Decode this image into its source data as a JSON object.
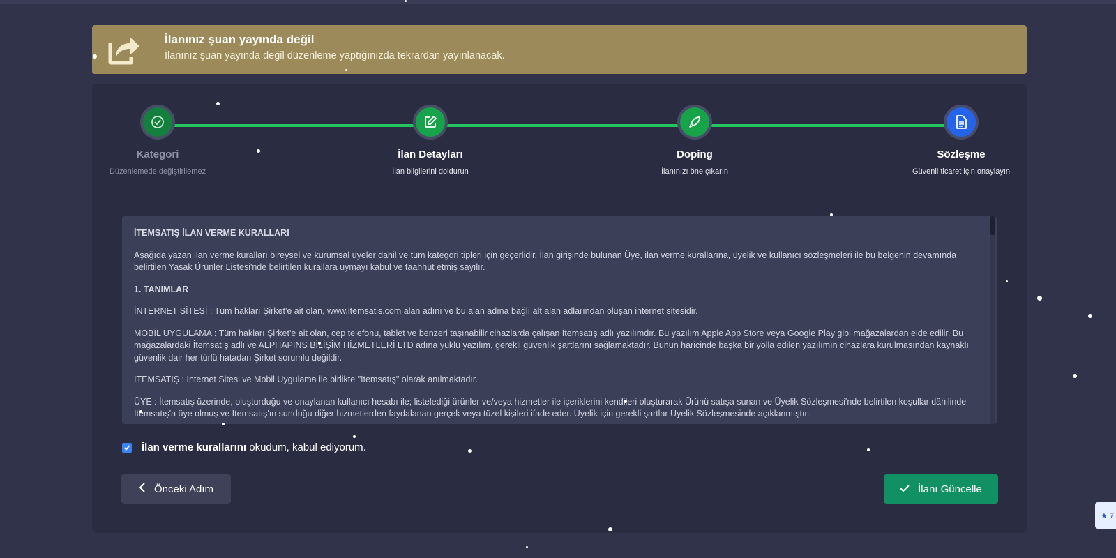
{
  "banner": {
    "title": "İlanınız şuan yayında değil",
    "subtitle": "İlanınız şuan yayında değil düzenleme yaptığınızda tekrardan yayınlanacak.",
    "icon": "share-export-icon"
  },
  "steps": [
    {
      "title": "Kategori",
      "subtitle": "Düzenlemede değiştirilemez",
      "icon": "check-circle-icon",
      "state": "disabled"
    },
    {
      "title": "İlan Detayları",
      "subtitle": "İlan bilgilerini doldurun",
      "icon": "edit-icon",
      "state": "done"
    },
    {
      "title": "Doping",
      "subtitle": "İlanınızı öne çıkarın",
      "icon": "rocket-icon",
      "state": "done"
    },
    {
      "title": "Sözleşme",
      "subtitle": "Güvenli ticaret için onaylayın",
      "icon": "document-icon",
      "state": "active"
    }
  ],
  "rules": {
    "heading": "İTEMSATIŞ İLAN VERME KURALLARI",
    "intro": "Aşağıda yazan ilan verme kuralları bireysel ve kurumsal üyeler dahil ve tüm kategori tipleri için geçerlidir. İlan girişinde bulunan Üye, ilan verme kurallarına, üyelik ve kullanıcı sözleşmeleri ile bu belgenin devamında belirtilen Yasak Ürünler Listesi'nde belirtilen kurallara uymayı kabul ve taahhüt etmiş sayılır.",
    "section1": "1. TANIMLAR",
    "def_internet": "İNTERNET SİTESİ : Tüm hakları Şirket'e ait olan, www.itemsatis.com alan adını ve bu alan adına bağlı alt alan adlarından oluşan internet sitesidir.",
    "def_mobile": "MOBİL UYGULAMA : Tüm hakları Şirket'e ait olan, cep telefonu, tablet ve benzeri taşınabilir cihazlarda çalışan İtemsatış adlı yazılımdır. Bu yazılım Apple App Store veya Google Play gibi mağazalardan elde edilir. Bu mağazalardaki İtemsatış adlı ve ALPHAPINS BİLİŞİM HİZMETLERİ LTD adına yüklü yazılım, gerekli güvenlik şartlarını sağlamaktadır. Bunun haricinde başka bir yolla edilen yazılımın cihazlara kurulmasından kaynaklı güvenlik dair her türlü hatadan Şirket sorumlu değildir.",
    "def_itemsatis": "İTEMSATIŞ : İnternet Sitesi ve Mobil Uygulama ile birlikte \"İtemsatış\" olarak anılmaktadır.",
    "def_uye": "ÜYE : İtemsatış üzerinde, oluşturduğu ve onaylanan kullanıcı hesabı ile; listelediği ürünler ve/veya hizmetler ile içeriklerini kendileri oluşturarak Ürünü satışa sunan ve Üyelik Sözleşmesi'nde belirtilen koşullar dâhilinde İtemsatış'a üye olmuş ve İtemsatış'ın sunduğu diğer hizmetlerden faydalanan gerçek veya tüzel kişileri ifade eder. Üyelik için gerekli şartlar Üyelik Sözleşmesinde açıklanmıştır."
  },
  "agreement": {
    "bold": "İlan verme kurallarını",
    "rest": " okudum, kabul ediyorum.",
    "checked": true
  },
  "buttons": {
    "prev": "Önceki Adım",
    "update": "İlanı Güncelle"
  },
  "rating_chip": "★ 7",
  "colors": {
    "background": "#30334a",
    "card": "#2a2c42",
    "banner": "#9c8a5a",
    "track": "#22c55e",
    "step_done": "#16a34a",
    "step_active": "#2563eb",
    "update_button": "#119063"
  }
}
